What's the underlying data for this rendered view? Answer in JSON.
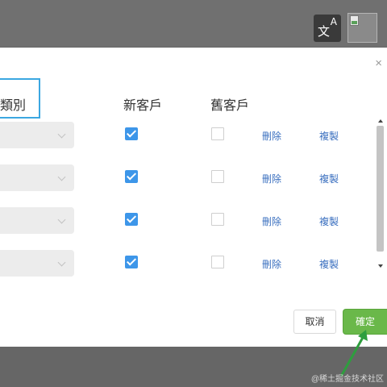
{
  "topbar": {
    "translate_icon_letter": "A",
    "translate_icon_char": "文"
  },
  "dialog": {
    "close_glyph": "×",
    "columns": {
      "type_header": "類別",
      "new_customer_header": "新客戶",
      "old_customer_header": "舊客戶"
    },
    "rows": [
      {
        "new_customer": true,
        "old_customer": false,
        "delete_label": "刪除",
        "copy_label": "複製"
      },
      {
        "new_customer": true,
        "old_customer": false,
        "delete_label": "刪除",
        "copy_label": "複製"
      },
      {
        "new_customer": true,
        "old_customer": false,
        "delete_label": "刪除",
        "copy_label": "複製"
      },
      {
        "new_customer": true,
        "old_customer": false,
        "delete_label": "刪除",
        "copy_label": "複製"
      }
    ],
    "footer": {
      "cancel_label": "取消",
      "confirm_label": "確定"
    }
  },
  "annotation": {
    "arrow_color": "#2e9e3e"
  },
  "watermark": "@稀土掘金技术社区",
  "colors": {
    "accent_blue": "#3d96e9",
    "confirm_green": "#6ab84a",
    "link_blue": "#3a6fbf",
    "focus_border": "#3ba7e1"
  }
}
